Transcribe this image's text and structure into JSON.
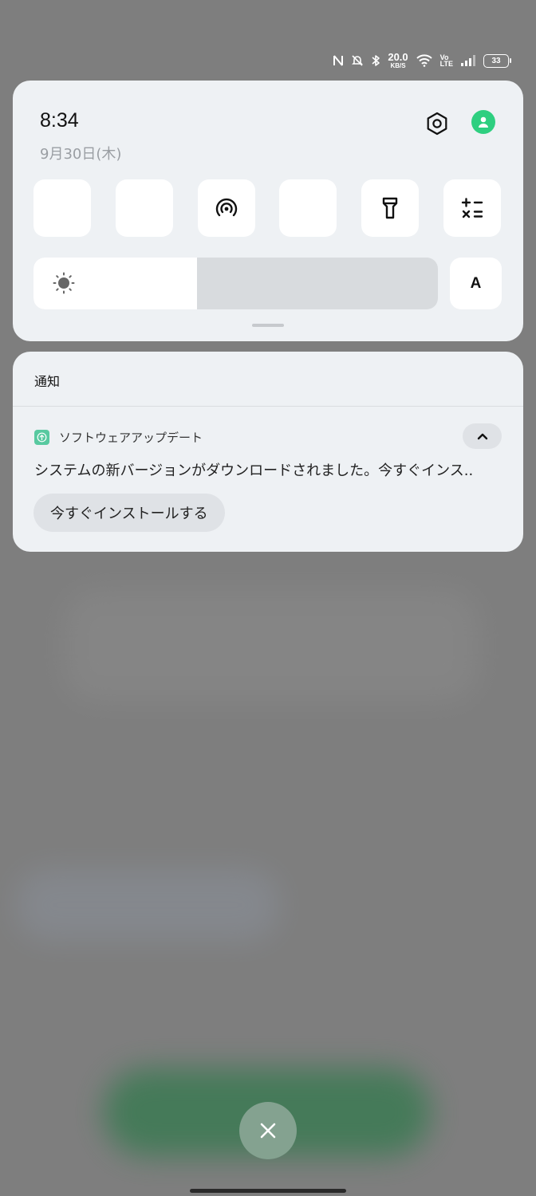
{
  "status_bar": {
    "speed_value": "20.0",
    "speed_unit": "KB/S",
    "volte_top": "Vo",
    "volte_bottom": "LTE",
    "battery": "33",
    "icons": [
      "nfc-icon",
      "mute-bell-icon",
      "bluetooth-icon",
      "wifi-icon",
      "signal-icon"
    ]
  },
  "quick_settings": {
    "time": "8:34",
    "date": "9月30日(木)",
    "tiles": [
      {
        "id": "wifi",
        "icon": "wifi-icon",
        "active": true
      },
      {
        "id": "mobile-data",
        "icon": "data-arrows-icon",
        "active": true
      },
      {
        "id": "hotspot",
        "icon": "hotspot-icon",
        "active": false
      },
      {
        "id": "bluetooth",
        "icon": "bluetooth-icon",
        "active": true
      },
      {
        "id": "flashlight",
        "icon": "flashlight-icon",
        "active": false
      },
      {
        "id": "calculator",
        "icon": "calculator-icon",
        "active": false
      }
    ],
    "brightness_level": 0.405,
    "auto_brightness_label": "A",
    "accent_color": "#2ecf80"
  },
  "notifications": {
    "header": "通知",
    "items": [
      {
        "app_name": "ソフトウェアアップデート",
        "text": "システムの新バージョンがダウンロードされました。今すぐインス..",
        "action_label": "今すぐインストールする"
      }
    ]
  }
}
